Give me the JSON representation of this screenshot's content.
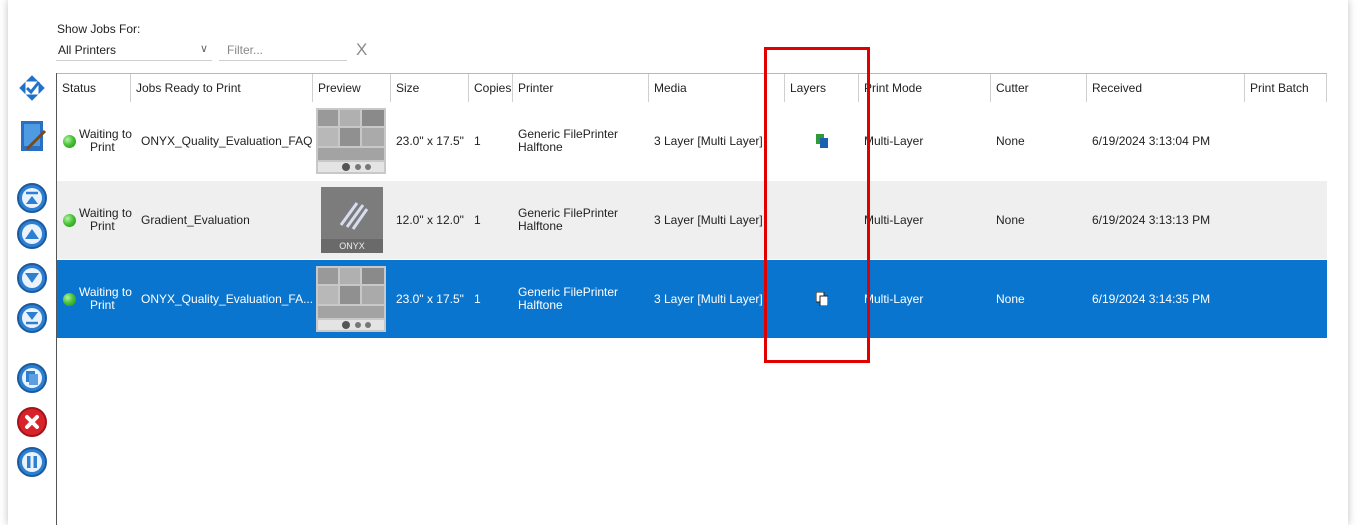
{
  "filters": {
    "show_jobs_label": "Show Jobs For:",
    "printer_value": "All Printers",
    "filter_placeholder": "Filter...",
    "clear_symbol": "X"
  },
  "toolbar": [
    {
      "name": "select-all-icon"
    },
    {
      "name": "edit-job-icon"
    },
    {
      "name": "move-to-top-icon"
    },
    {
      "name": "move-up-icon"
    },
    {
      "name": "move-down-icon"
    },
    {
      "name": "move-to-bottom-icon"
    },
    {
      "name": "duplicate-icon"
    },
    {
      "name": "delete-icon"
    },
    {
      "name": "pause-icon"
    }
  ],
  "table": {
    "columns": [
      "Status",
      "Jobs Ready to Print",
      "Preview",
      "Size",
      "Copies",
      "Printer",
      "Media",
      "Layers",
      "Print Mode",
      "Cutter",
      "Received",
      "Print Batch"
    ],
    "rows": [
      {
        "status_line1": "Waiting to",
        "status_line2": "Print",
        "job": "ONYX_Quality_Evaluation_FAQ",
        "preview": "quality-evaluation-thumbnail",
        "size": "23.0\" x 17.5\"",
        "copies": "1",
        "printer_line1": "Generic FilePrinter",
        "printer_line2": "Halftone",
        "media": "3 Layer [Multi Layer]",
        "layers_icon": "layers-icon",
        "print_mode": "Multi-Layer",
        "cutter": "None",
        "received": "6/19/2024 3:13:04 PM",
        "print_batch": ""
      },
      {
        "status_line1": "Waiting to",
        "status_line2": "Print",
        "job": "Gradient_Evaluation",
        "preview": "onyx-logo-thumbnail",
        "preview_text": "ONYX",
        "size": "12.0\" x 12.0\"",
        "copies": "1",
        "printer_line1": "Generic FilePrinter",
        "printer_line2": "Halftone",
        "media": "3 Layer [Multi Layer]",
        "layers_icon": "",
        "print_mode": "Multi-Layer",
        "cutter": "None",
        "received": "6/19/2024 3:13:13 PM",
        "print_batch": ""
      },
      {
        "status_line1": "Waiting to",
        "status_line2": "Print",
        "job": "ONYX_Quality_Evaluation_FA...",
        "preview": "quality-evaluation-thumbnail",
        "size": "23.0\" x 17.5\"",
        "copies": "1",
        "printer_line1": "Generic FilePrinter",
        "printer_line2": "Halftone",
        "media": "3 Layer [Multi Layer]",
        "layers_icon": "layers-icon",
        "print_mode": "Multi-Layer",
        "cutter": "None",
        "received": "6/19/2024 3:14:35 PM",
        "print_batch": "",
        "selected": true
      }
    ]
  },
  "highlight": {
    "color": "#e00000",
    "target": "Layers"
  },
  "colors": {
    "selection": "#0a75cf",
    "alt_row": "#efefef",
    "status_green": "#4cc43a"
  }
}
